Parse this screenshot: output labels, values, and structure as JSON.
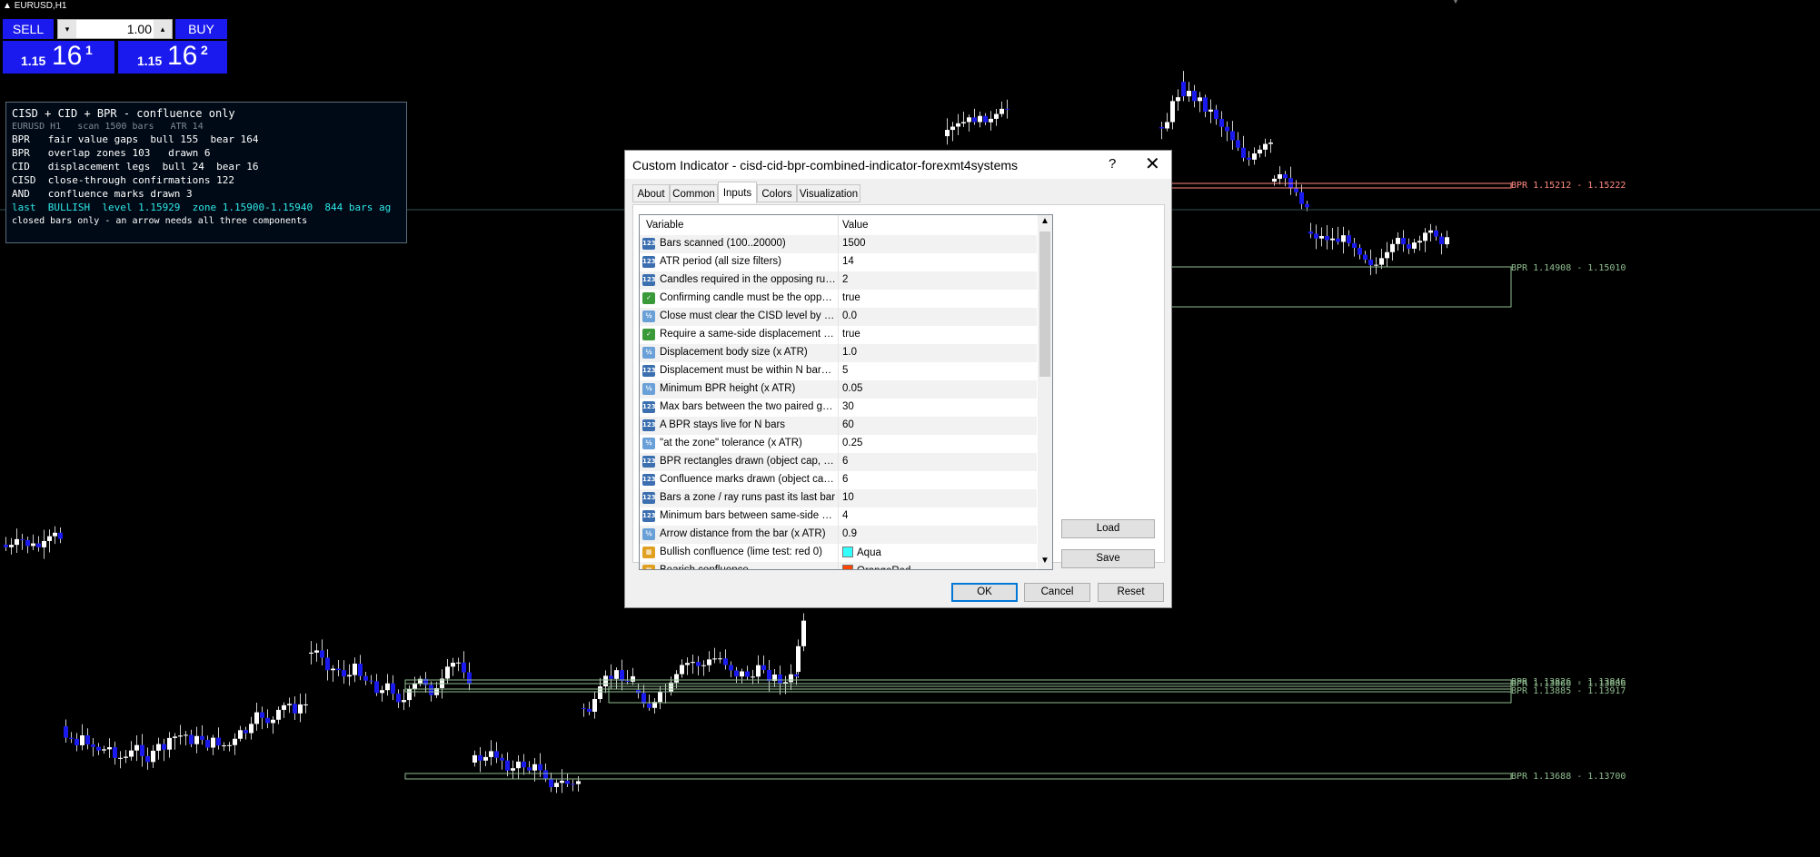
{
  "symbol_label": "EURUSD,H1",
  "trade_panel": {
    "sell_label": "SELL",
    "buy_label": "BUY",
    "lot_value": "1.00",
    "lot_down": "▾",
    "lot_up": "▴",
    "bid": {
      "small": "1.15",
      "big": "16",
      "sup": "1"
    },
    "ask": {
      "small": "1.15",
      "big": "16",
      "sup": "2"
    }
  },
  "info_panel": {
    "title": "CISD + CID + BPR - confluence only",
    "subtitle": "EURUSD H1   scan 1500 bars   ATR 14",
    "lines": [
      "BPR   fair value gaps  bull 155  bear 164",
      "BPR   overlap zones 103   drawn 6",
      "CID   displacement legs  bull 24  bear 16",
      "CISD  close-through confirmations 122",
      "AND   confluence marks drawn 3"
    ],
    "last_line": "last  BULLISH  level 1.15929  zone 1.15900-1.15940  844 bars ag",
    "footer": "closed bars only - an arrow needs all three components"
  },
  "bpr_labels": [
    "BPR 1.15212 - 1.15222",
    "BPR 1.14908 - 1.15010",
    "BPR 1.13826 - 1.13846",
    "BPR 1.13866 - 1.13886",
    "BPR 1.13885 - 1.13917",
    "BPR 1.13688 - 1.13700"
  ],
  "dialog": {
    "title": "Custom Indicator - cisd-cid-bpr-combined-indicator-forexmt4systems",
    "help": "?",
    "close": "✕",
    "tabs": [
      "About",
      "Common",
      "Inputs",
      "Colors",
      "Visualization"
    ],
    "active_tab": "Inputs",
    "col_variable": "Variable",
    "col_value": "Value",
    "rows": [
      {
        "type": "int",
        "icon": "123",
        "name": "Bars scanned (100..20000)",
        "value": "1500"
      },
      {
        "type": "int",
        "icon": "123",
        "name": "ATR period (all size filters)",
        "value": "14"
      },
      {
        "type": "int",
        "icon": "123",
        "name": "Candles required in the opposing run (1...",
        "value": "2"
      },
      {
        "type": "bool",
        "icon": "✓",
        "name": "Confirming candle must be the opposit...",
        "value": "true"
      },
      {
        "type": "dbl",
        "icon": "½",
        "name": "Close must clear the CISD level by N p...",
        "value": "0.0"
      },
      {
        "type": "bool",
        "icon": "✓",
        "name": "Require a same-side displacement leg",
        "value": "true"
      },
      {
        "type": "dbl",
        "icon": "½",
        "name": "Displacement body size (x ATR)",
        "value": "1.0"
      },
      {
        "type": "int",
        "icon": "123",
        "name": "Displacement must be within N bars of ...",
        "value": "5"
      },
      {
        "type": "dbl",
        "icon": "½",
        "name": "Minimum BPR height (x ATR)",
        "value": "0.05"
      },
      {
        "type": "int",
        "icon": "123",
        "name": "Max bars between the two paired gaps",
        "value": "30"
      },
      {
        "type": "int",
        "icon": "123",
        "name": "A BPR stays live for N bars",
        "value": "60"
      },
      {
        "type": "dbl",
        "icon": "½",
        "name": "\"at the zone\" tolerance (x ATR)",
        "value": "0.25"
      },
      {
        "type": "int",
        "icon": "123",
        "name": "BPR rectangles drawn (object cap, 1.....",
        "value": "6"
      },
      {
        "type": "int",
        "icon": "123",
        "name": "Confluence marks drawn (object cap, ...",
        "value": "6"
      },
      {
        "type": "int",
        "icon": "123",
        "name": "Bars a zone / ray runs past its last bar",
        "value": "10"
      },
      {
        "type": "int",
        "icon": "123",
        "name": "Minimum bars between same-side arrows",
        "value": "4"
      },
      {
        "type": "dbl",
        "icon": "½",
        "name": "Arrow distance from the bar (x ATR)",
        "value": "0.9"
      },
      {
        "type": "clr",
        "icon": "▦",
        "name": "Bullish confluence (lime test: red 0)",
        "value": "Aqua",
        "swatch": "#33ffff"
      },
      {
        "type": "clr",
        "icon": "▦",
        "name": "Bearish confluence",
        "value": "OrangeRed",
        "swatch": "#ff4500"
      }
    ],
    "load_label": "Load",
    "save_label": "Save",
    "ok_label": "OK",
    "cancel_label": "Cancel",
    "reset_label": "Reset"
  },
  "colors": {
    "bull_candle": "#ffffff",
    "bear_candle": "#1a1aee",
    "bpr_line": "#8fbc8f",
    "bpr_upper_line": "#ff8a80"
  }
}
